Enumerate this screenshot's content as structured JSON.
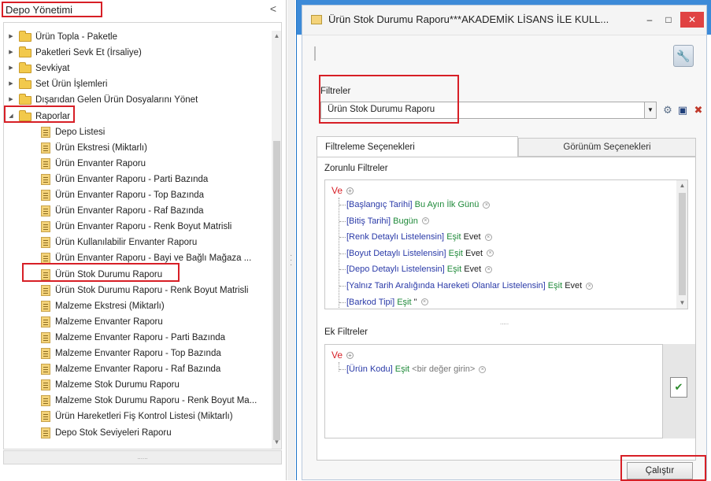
{
  "left_panel": {
    "title": "Depo Yönetimi",
    "collapse_glyph": "<",
    "bottom_grip": "......",
    "tree": [
      {
        "type": "folder",
        "label": "Ürün Topla - Paketle",
        "expanded": false
      },
      {
        "type": "folder",
        "label": "Paketleri Sevk Et (İrsaliye)",
        "expanded": false
      },
      {
        "type": "folder",
        "label": "Sevkiyat",
        "expanded": false
      },
      {
        "type": "folder",
        "label": "Set Ürün İşlemleri",
        "expanded": false
      },
      {
        "type": "folder",
        "label": "Dışarıdan Gelen Ürün Dosyalarını Yönet",
        "expanded": false
      },
      {
        "type": "folder",
        "label": "Raporlar",
        "expanded": true
      },
      {
        "type": "report",
        "label": "Depo Listesi"
      },
      {
        "type": "report",
        "label": "Ürün Ekstresi (Miktarlı)"
      },
      {
        "type": "report",
        "label": "Ürün Envanter Raporu"
      },
      {
        "type": "report",
        "label": "Ürün Envanter Raporu - Parti Bazında"
      },
      {
        "type": "report",
        "label": "Ürün Envanter Raporu - Top Bazında"
      },
      {
        "type": "report",
        "label": "Ürün Envanter Raporu - Raf Bazında"
      },
      {
        "type": "report",
        "label": "Ürün Envanter Raporu - Renk Boyut Matrisli"
      },
      {
        "type": "report",
        "label": "Ürün Kullanılabilir Envanter Raporu"
      },
      {
        "type": "report",
        "label": "Ürün Envanter Raporu - Bayi ve Bağlı Mağaza ..."
      },
      {
        "type": "report",
        "label": "Ürün Stok Durumu Raporu",
        "selected": true
      },
      {
        "type": "report",
        "label": "Ürün Stok Durumu Raporu - Renk Boyut Matrisli"
      },
      {
        "type": "report",
        "label": "Malzeme Ekstresi (Miktarlı)"
      },
      {
        "type": "report",
        "label": "Malzeme Envanter Raporu"
      },
      {
        "type": "report",
        "label": "Malzeme Envanter Raporu - Parti Bazında"
      },
      {
        "type": "report",
        "label": "Malzeme Envanter Raporu - Top Bazında"
      },
      {
        "type": "report",
        "label": "Malzeme Envanter Raporu - Raf Bazında"
      },
      {
        "type": "report",
        "label": "Malzeme Stok Durumu Raporu"
      },
      {
        "type": "report",
        "label": "Malzeme Stok Durumu Raporu - Renk Boyut Ma..."
      },
      {
        "type": "report",
        "label": "Ürün Hareketleri Fiş Kontrol Listesi (Miktarlı)"
      },
      {
        "type": "report",
        "label": "Depo Stok Seviyeleri Raporu"
      }
    ]
  },
  "window": {
    "title": "Ürün Stok Durumu Raporu***AKADEMİK LİSANS İLE KULL...",
    "min_glyph": "–",
    "max_glyph": "□",
    "close_glyph": "✕",
    "filters_label": "Filtreler",
    "filters_value": "Ürün Stok Durumu Raporu",
    "tabs": [
      {
        "label": "Filtreleme Seçenekleri",
        "active": true
      },
      {
        "label": "Görünüm Seçenekleri",
        "active": false
      }
    ],
    "required_label": "Zorunlu Filtreler",
    "extra_label": "Ek Filtreler",
    "and_label": "Ve",
    "mid_grip": ".....",
    "required_filters": [
      {
        "field": "[Başlangıç Tarihi]",
        "op": "Bu Ayın İlk Günü",
        "value": ""
      },
      {
        "field": "[Bitiş Tarihi]",
        "op": "Bugün",
        "value": ""
      },
      {
        "field": "[Renk Detaylı Listelensin]",
        "op": "Eşit",
        "value": "Evet"
      },
      {
        "field": "[Boyut Detaylı Listelensin]",
        "op": "Eşit",
        "value": "Evet"
      },
      {
        "field": "[Depo Detaylı Listelensin]",
        "op": "Eşit",
        "value": "Evet"
      },
      {
        "field": "[Yalnız Tarih Aralığında Hareketi Olanlar Listelensin]",
        "op": "Eşit",
        "value": "Evet"
      },
      {
        "field": "[Barkod Tipi]",
        "op": "Eşit",
        "value": "\""
      }
    ],
    "extra_filters": [
      {
        "field": "[Ürün Kodu]",
        "op": "Eşit",
        "placeholder": "<bir değer girin>"
      }
    ],
    "run_button": "Çalıştır"
  },
  "colors": {
    "highlight": "#d71f26",
    "title_bar": "#3c8ad8",
    "close": "#e04343",
    "field_text": "#2a3aa8",
    "operator_text": "#1f8a3a"
  }
}
